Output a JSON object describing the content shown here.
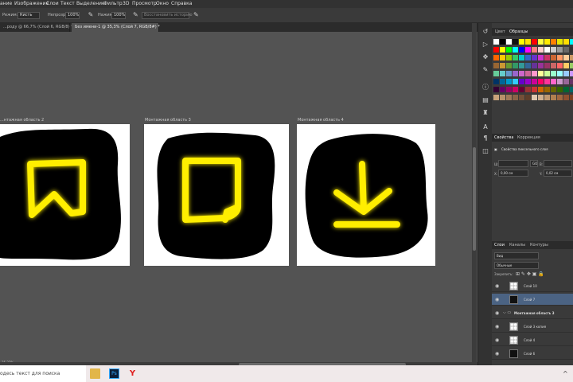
{
  "menu": {
    "items": [
      "ание",
      "Изображение",
      "Слои",
      "Текст",
      "Выделение",
      "Фильтр",
      "3D",
      "Просмотр",
      "Окно",
      "Справка"
    ]
  },
  "options": {
    "mode_label": "Режим:",
    "mode_value": "Кисть",
    "opacity_label": "Непрозр.:",
    "opacity_value": "100%",
    "flow_label": "Нажим:",
    "flow_value": "100%",
    "history_label": "Восстановить историю"
  },
  "tabs": [
    {
      "label": "...роду @ 66,7% (Слой 6, RGB/8) *"
    },
    {
      "label": "Без имени-1 @ 35,3% (Слой 7, RGB/8#) *"
    }
  ],
  "canvas": {
    "artboards": [
      {
        "label": "...нтажная область 2"
      },
      {
        "label": "Монтажная область 3"
      },
      {
        "label": "Монтажная область 4"
      }
    ],
    "glow_color": "#ffee00",
    "blob_color": "#000000"
  },
  "status": {
    "zoom": "35,27%"
  },
  "panels": {
    "swatch_tabs": [
      "Цвет",
      "Образцы"
    ],
    "props_tabs": [
      "Свойства",
      "Коррекция"
    ],
    "props_title": "Свойства пиксельного слоя",
    "props_fields": {
      "w_label": "Ш:",
      "h_label": "В:",
      "x_label": "X:",
      "y_label": "Y:",
      "x_value": "0,00 см",
      "y_value": "0,02 см",
      "link": "GO"
    },
    "layers_tabs": [
      "Слои",
      "Каналы",
      "Контуры"
    ],
    "filter_value": "Вид",
    "blend_value": "Обычные",
    "lock_label": "Закрепить:",
    "layers": [
      {
        "name": "Слой 10",
        "thumb": "checker",
        "selected": false
      },
      {
        "name": "Слой 7",
        "thumb": "black",
        "selected": true
      },
      {
        "name": "Монтажная область 3",
        "thumb": "none",
        "selected": false
      },
      {
        "name": "Слой 3 копия",
        "thumb": "checker",
        "selected": false
      },
      {
        "name": "Слой 4",
        "thumb": "checker",
        "selected": false
      },
      {
        "name": "Слой 6",
        "thumb": "black",
        "selected": false
      }
    ]
  },
  "taskbar": {
    "search_placeholder": "одесь текст для поиска"
  }
}
